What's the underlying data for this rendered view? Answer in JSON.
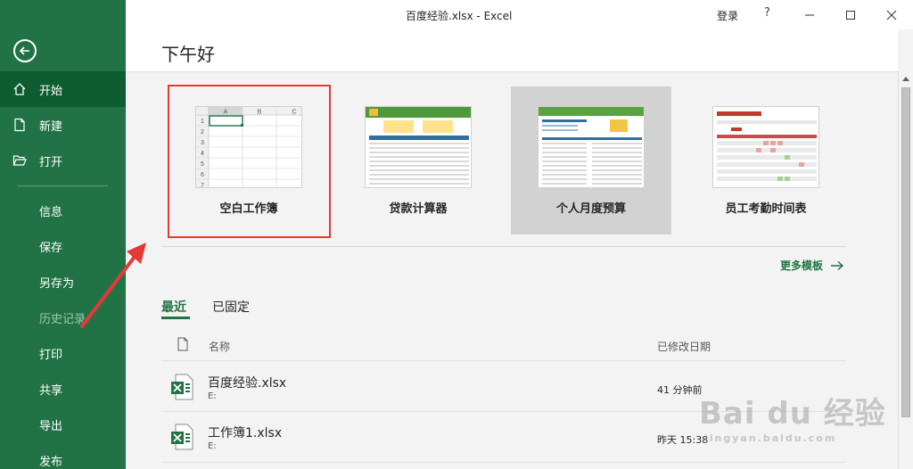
{
  "window": {
    "title": "百度经验.xlsx  -  Excel",
    "login": "登录",
    "help": "?"
  },
  "sidebar": {
    "items": [
      {
        "label": "开始",
        "icon": "home-icon"
      },
      {
        "label": "新建",
        "icon": "new-doc-icon"
      },
      {
        "label": "打开",
        "icon": "folder-open-icon"
      },
      {
        "label": "信息"
      },
      {
        "label": "保存"
      },
      {
        "label": "另存为"
      },
      {
        "label": "历史记录"
      },
      {
        "label": "打印"
      },
      {
        "label": "共享"
      },
      {
        "label": "导出"
      },
      {
        "label": "发布"
      }
    ]
  },
  "main": {
    "greeting": "下午好",
    "templates": [
      {
        "label": "空白工作簿"
      },
      {
        "label": "贷款计算器"
      },
      {
        "label": "个人月度预算"
      },
      {
        "label": "员工考勤时间表"
      }
    ],
    "more_templates": "更多模板",
    "tabs": [
      {
        "label": "最近"
      },
      {
        "label": "已固定"
      }
    ],
    "columns": {
      "name": "名称",
      "modified": "已修改日期"
    },
    "files": [
      {
        "name": "百度经验.xlsx",
        "path": "E:",
        "date": "41 分钟前"
      },
      {
        "name": "工作簿1.xlsx",
        "path": "E:",
        "date": "昨天 15:38"
      }
    ]
  },
  "blank_thumb": {
    "col_a": "A",
    "col_b": "B",
    "col_c": "C",
    "rows": [
      "1",
      "2",
      "3",
      "4",
      "5",
      "6",
      "7"
    ]
  },
  "watermark": {
    "main": "Bai du 经验",
    "sub": "jingyan.baidu.com"
  },
  "colors": {
    "accent": "#217346",
    "highlight_border": "#e53935"
  }
}
